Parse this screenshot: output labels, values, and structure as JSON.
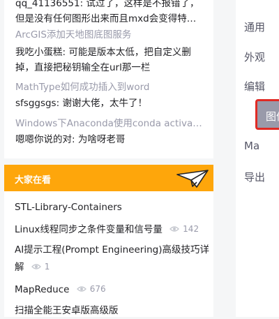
{
  "comments": [
    {
      "title": "",
      "user": "qq_41136551",
      "text": "试过了，这样是不报错了，但是没有任何图形出来而且mxd会变得特…"
    },
    {
      "title": "ArcGIS添加天地图底图服务",
      "user": "我吃小蛋糕",
      "text": "可能是版本太低，把自定义删掉，直接把秘钥输全在url那一栏"
    },
    {
      "title": "MathType如何成功插入到word",
      "user": "sfsggsgs",
      "text": "谢谢大佬，太牛了！"
    },
    {
      "title": "Windows下Anaconda使用conda activate…",
      "user": "嗯嗯你说的对",
      "text": "为啥呀老哥"
    }
  ],
  "trending": {
    "header": "大家在看",
    "items": [
      {
        "title": "STL-Library-Containers",
        "views": ""
      },
      {
        "title": "Linux线程同步之条件变量和信号量",
        "views": "142"
      },
      {
        "title": "AI提示工程(Prompt Engineering)高级技巧详解",
        "views": "1"
      },
      {
        "title": "MapReduce",
        "views": "676"
      },
      {
        "title": "扫描全能王安卓版高级版",
        "views": ""
      }
    ]
  },
  "right_nav": {
    "items": [
      "通用",
      "外观",
      "编辑",
      "图像",
      "Ma",
      "导出"
    ],
    "active_index": 3
  },
  "colors": {
    "accent": "#fea60b",
    "active_bg": "#999aaa",
    "active_border": "#e02a24"
  }
}
